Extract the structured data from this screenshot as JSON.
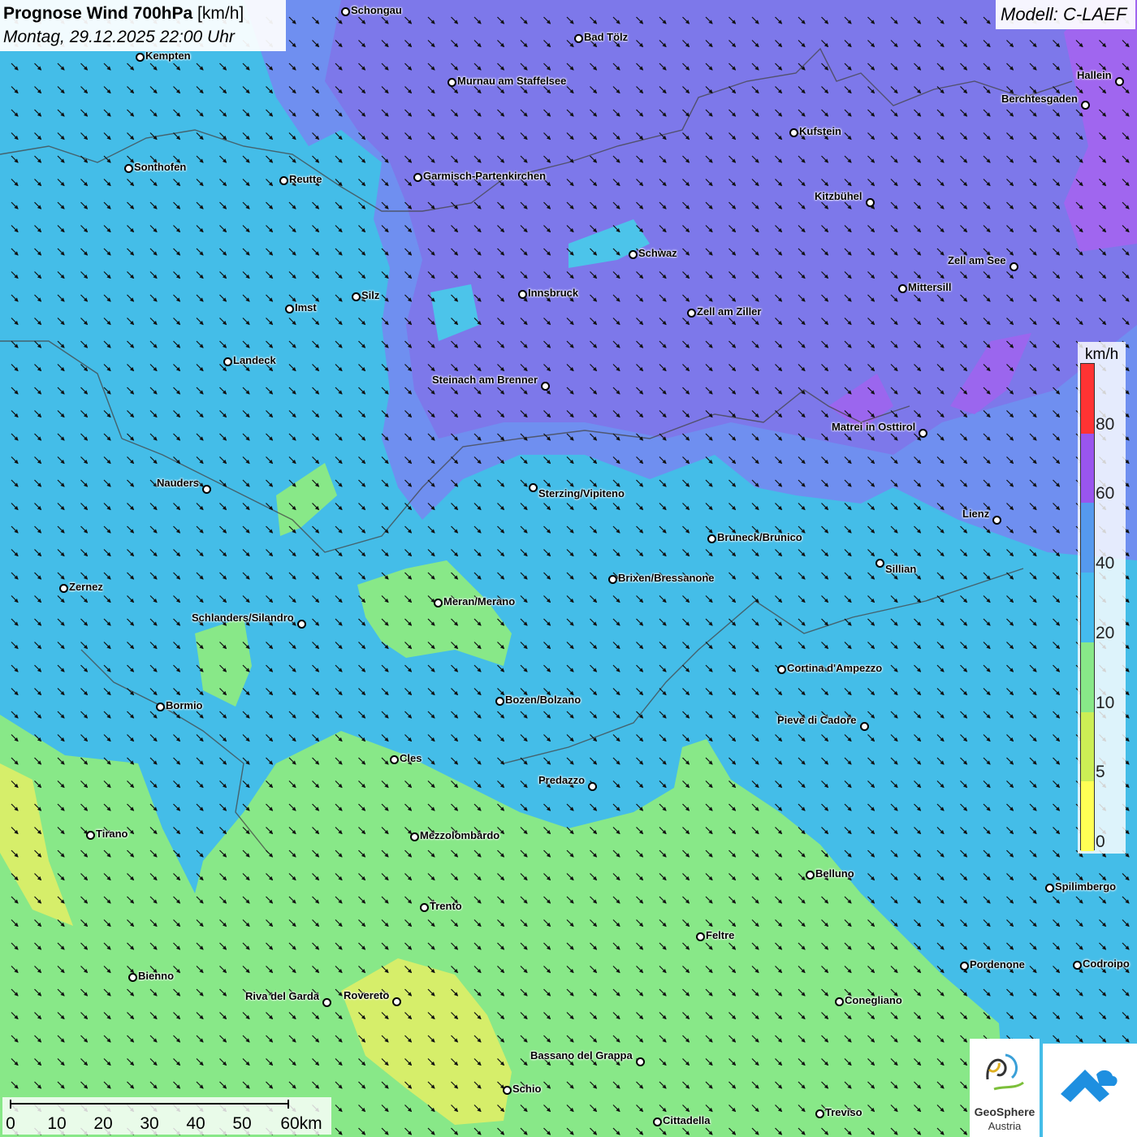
{
  "header": {
    "title": "Prognose Wind 700hPa",
    "title_unit": "[km/h]",
    "datetime": "Montag, 29.12.2025 22:00 Uhr"
  },
  "model": {
    "label": "Modell: C-LAEF"
  },
  "legend": {
    "unit": "km/h",
    "ticks": [
      "0",
      "5",
      "10",
      "20",
      "40",
      "60",
      "80"
    ],
    "colors": [
      "#ffff55",
      "#ccee55",
      "#88e888",
      "#44bbee",
      "#5599ee",
      "#9955ee",
      "#ff3333"
    ]
  },
  "map_colors": {
    "low_green": "#88e888",
    "mid_cyan": "#44bde8",
    "high_blue": "#5d9cf0",
    "purple": "#7c6ee8",
    "violet": "#a060f0",
    "yellow": "#d8ee66"
  },
  "wind_direction": "north-west",
  "cities": [
    "Schongau",
    "Bad Tölz",
    "Kempten",
    "Murnau am Staffelsee",
    "Hallein",
    "Berchtesgaden",
    "Kufstein",
    "Sonthofen",
    "Reutte",
    "Garmisch-Partenkirchen",
    "Kitzbühel",
    "Schwaz",
    "Zell am See",
    "Innsbruck",
    "Mittersill",
    "Silz",
    "Imst",
    "Zell am Ziller",
    "Landeck",
    "Steinach am Brenner",
    "Matrei in Osttirol",
    "Nauders",
    "Sterzing/Vipiteno",
    "Lienz",
    "Bruneck/Brunico",
    "Sillian",
    "Zernez",
    "Brixen/Bressanone",
    "Meran/Merano",
    "Schlanders/Silandro",
    "Cortina d'Ampezzo",
    "Bozen/Bolzano",
    "Bormio",
    "Pieve di Cadore",
    "Cles",
    "Predazzo",
    "Tirano",
    "Mezzolombardo",
    "Belluno",
    "Spilimbergo",
    "Trento",
    "Feltre",
    "Pordenone",
    "Codroipo",
    "Bienno",
    "Riva del Garda",
    "Rovereto",
    "Conegliano",
    "Bassano del Grappa",
    "Schio",
    "Treviso",
    "Cittadella"
  ],
  "scale": {
    "labels": [
      "0",
      "10",
      "20",
      "30",
      "40",
      "50",
      "60km"
    ]
  },
  "logos": {
    "geosphere_name": "GeoSphere",
    "geosphere_sub": "Austria"
  }
}
